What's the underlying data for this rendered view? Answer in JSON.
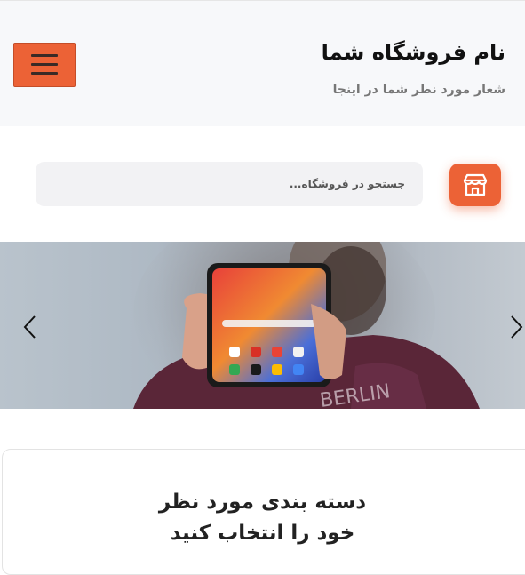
{
  "header": {
    "store_name": "نام فروشگاه شما",
    "slogan": "شعار مورد نظر شما در اینجا",
    "menu_icon": "hamburger-icon"
  },
  "search": {
    "placeholder": "جستجو در فروشگاه...",
    "value": "",
    "store_icon": "store-icon"
  },
  "slider": {
    "image_subject": "person holding smartphone",
    "prev_icon": "chevron-left-icon",
    "next_icon": "chevron-right-icon"
  },
  "categories": {
    "title_line1": "دسته بندی مورد نظر",
    "title_line2": "خود را انتخاب کنید"
  },
  "colors": {
    "accent": "#ec6236",
    "header_bg": "#f7f8fa",
    "search_bg": "#f2f2f4"
  }
}
